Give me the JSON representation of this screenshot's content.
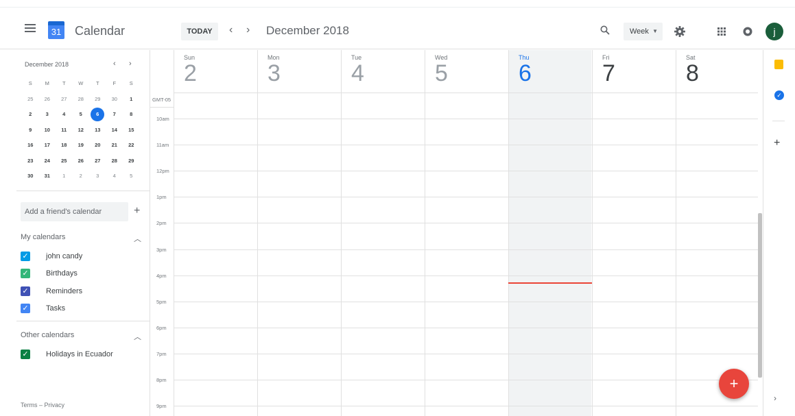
{
  "app": {
    "title": "Calendar",
    "logo_day": "31"
  },
  "header": {
    "today_label": "TODAY",
    "prev_label": "‹",
    "next_label": "›",
    "period_title": "December 2018",
    "view_selected": "Week",
    "avatar_letter": "j"
  },
  "mini_calendar": {
    "month_title": "December 2018",
    "prev_label": "‹",
    "next_label": "›",
    "weekdays": [
      "S",
      "M",
      "T",
      "W",
      "T",
      "F",
      "S"
    ],
    "weeks": [
      [
        "25",
        "26",
        "27",
        "28",
        "29",
        "30",
        "1"
      ],
      [
        "2",
        "3",
        "4",
        "5",
        "6",
        "7",
        "8"
      ],
      [
        "9",
        "10",
        "11",
        "12",
        "13",
        "14",
        "15"
      ],
      [
        "16",
        "17",
        "18",
        "19",
        "20",
        "21",
        "22"
      ],
      [
        "23",
        "24",
        "25",
        "26",
        "27",
        "28",
        "29"
      ],
      [
        "30",
        "31",
        "1",
        "2",
        "3",
        "4",
        "5"
      ]
    ],
    "selected_day": "6"
  },
  "sidebar": {
    "add_friend_placeholder": "Add a friend's calendar",
    "add_label": "+",
    "my_calendars_title": "My calendars",
    "my_calendars": [
      {
        "label": "john candy",
        "color": "#039be5"
      },
      {
        "label": "Birthdays",
        "color": "#33b679"
      },
      {
        "label": "Reminders",
        "color": "#3f51b5"
      },
      {
        "label": "Tasks",
        "color": "#4285f4"
      }
    ],
    "other_calendars_title": "Other calendars",
    "other_calendars": [
      {
        "label": "Holidays in Ecuador",
        "color": "#0b8043"
      }
    ],
    "footer": "Terms – Privacy"
  },
  "week": {
    "timezone": "GMT-05",
    "days": [
      {
        "dow": "Sun",
        "num": "2",
        "state": "past"
      },
      {
        "dow": "Mon",
        "num": "3",
        "state": "past"
      },
      {
        "dow": "Tue",
        "num": "4",
        "state": "past"
      },
      {
        "dow": "Wed",
        "num": "5",
        "state": "past"
      },
      {
        "dow": "Thu",
        "num": "6",
        "state": "current"
      },
      {
        "dow": "Fri",
        "num": "7",
        "state": "future"
      },
      {
        "dow": "Sat",
        "num": "8",
        "state": "future"
      }
    ],
    "hours": [
      "10am",
      "11am",
      "12pm",
      "1pm",
      "2pm",
      "3pm",
      "4pm",
      "5pm",
      "6pm",
      "7pm",
      "8pm",
      "9pm"
    ]
  },
  "right_rail": {
    "add_label": "+",
    "expand_label": "›"
  },
  "fab": {
    "label": "+"
  }
}
